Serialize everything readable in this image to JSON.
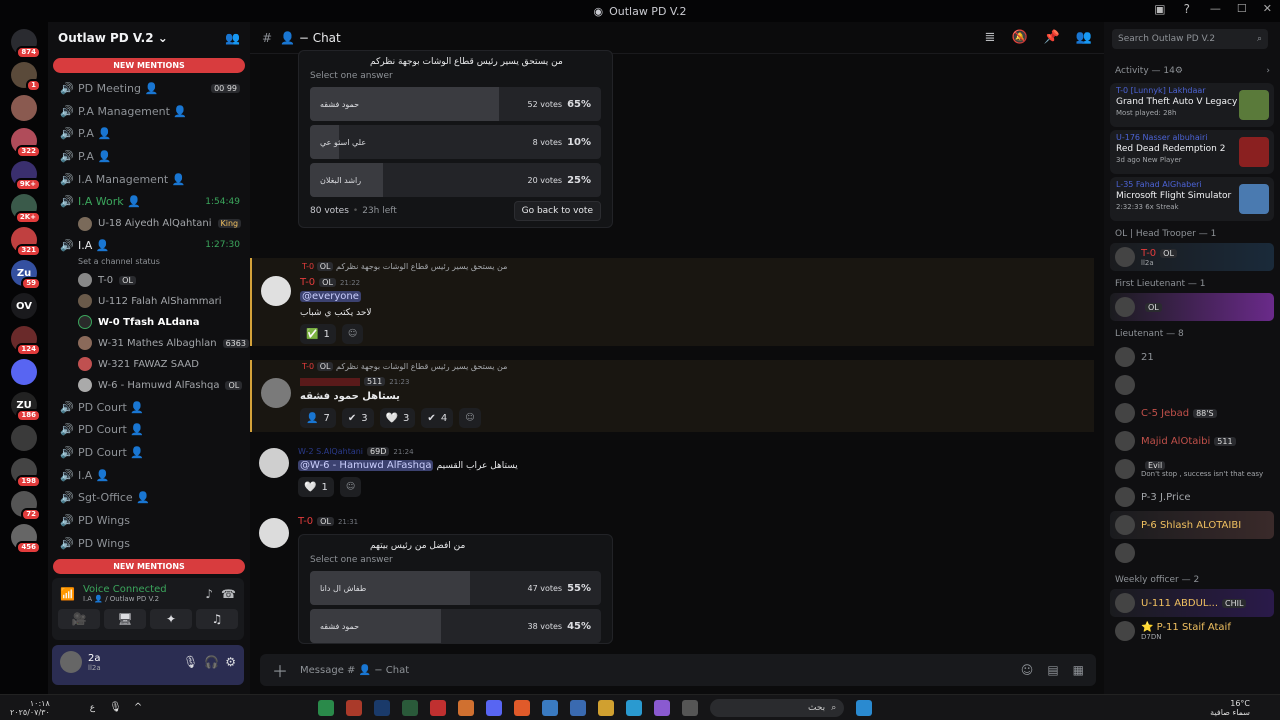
{
  "window": {
    "title": "Outlaw PD V.2"
  },
  "servers": [
    {
      "label": "",
      "badge": "874",
      "color": "#2a2b30"
    },
    {
      "label": "",
      "badge": "1",
      "color": "#5a4a3a"
    },
    {
      "label": "",
      "badge": "",
      "color": "#8a5a50"
    },
    {
      "label": "",
      "badge": "322",
      "color": "#b04c5a"
    },
    {
      "label": "",
      "badge": "9K+",
      "color": "#3a2f6e"
    },
    {
      "label": "",
      "badge": "2K+",
      "color": "#3a5a4a"
    },
    {
      "label": "",
      "badge": "321",
      "color": "#c04040"
    },
    {
      "label": "Zu",
      "badge": "59",
      "color": "#3450a0"
    },
    {
      "label": "OV",
      "badge": "",
      "color": "#1a1a1d"
    },
    {
      "label": "",
      "badge": "124",
      "color": "#6a2a2a"
    },
    {
      "label": "",
      "badge": "",
      "color": "#5865f2"
    },
    {
      "label": "ZU",
      "badge": "186",
      "color": "#222"
    },
    {
      "label": "",
      "badge": "",
      "color": "#3a3a3a"
    },
    {
      "label": "",
      "badge": "198",
      "color": "#444"
    },
    {
      "label": "",
      "badge": "72",
      "color": "#555"
    },
    {
      "label": "",
      "badge": "456",
      "color": "#666"
    }
  ],
  "sidebar": {
    "guild_name": "Outlaw PD V.2",
    "new_mentions": "NEW MENTIONS",
    "new_label": "NEW",
    "channels": [
      {
        "name": "PD Meeting 👤",
        "time": "",
        "badge": "00 99"
      },
      {
        "name": "P.A Management 👤",
        "time": ""
      },
      {
        "name": "P.A 👤",
        "time": ""
      },
      {
        "name": "P.A 👤",
        "time": ""
      },
      {
        "name": "I.A Management 👤",
        "time": ""
      },
      {
        "name": "I.A Work 👤",
        "time": "1:54:49",
        "active": true
      }
    ],
    "ia_work_user": "U-18 Aiyedh AlQahtani",
    "ia_work_tag": "King",
    "ia_channel": "I.A 👤",
    "ia_time": "1:27:30",
    "set_status": "Set a channel status",
    "ia_users": [
      {
        "name": "T-0",
        "tag": "OL"
      },
      {
        "name": "U-112 Falah AlShammari",
        "tag": ""
      },
      {
        "name": "W-0 Tfash ALdana",
        "tag": ""
      },
      {
        "name": "W-31 Mathes Albaghlan",
        "tag": "6363"
      },
      {
        "name": "W-321 FAWAZ SAAD",
        "tag": ""
      },
      {
        "name": "W-6 - Hamuwd AlFashqa",
        "tag": "OL"
      }
    ],
    "more_channels": [
      "PD Court 👤",
      "PD Court 👤",
      "PD Court 👤",
      "I.A 👤",
      "Sgt-Office 👤",
      "PD Wings",
      "PD Wings",
      "PD Waiting"
    ]
  },
  "voice": {
    "status": "Voice Connected",
    "location": "I.A 👤 / Outlaw PD V.2"
  },
  "user": {
    "name": "2a",
    "sub": "ll2a"
  },
  "header": {
    "channel": "👤 − Chat",
    "search_placeholder": "Search Outlaw PD V.2"
  },
  "poll1": {
    "question": "من يستحق يسير رئيس قطاع الوشات بوجهة نظركم",
    "select": "Select one answer",
    "answers": [
      {
        "label": "حمود فشقه",
        "votes": "52 votes",
        "pct": "65%",
        "frac": 0.65
      },
      {
        "label": "علي اسثو عي",
        "votes": "8 votes",
        "pct": "10%",
        "frac": 0.1
      },
      {
        "label": "راشد البغلان",
        "votes": "20 votes",
        "pct": "25%",
        "frac": 0.25
      }
    ],
    "total": "80 votes",
    "left": "23h left",
    "button": "Go back to vote"
  },
  "msg1": {
    "reply": "من يستحق يسير رئيس قطاع الوشات بوجهة نظركم",
    "reply_user": "T-0",
    "reply_tag": "OL",
    "user": "T-0",
    "tag": "OL",
    "time": "21:22",
    "mention": "@everyone",
    "text": "لاحد يكتب ي شباب",
    "reactions": [
      {
        "emoji": "✅",
        "count": "1"
      }
    ]
  },
  "msg2": {
    "reply": "من يستحق يسير رئيس قطاع الوشات بوجهة نظركم",
    "reply_user": "T-0",
    "reply_tag": "OL",
    "user": "",
    "tag": "511",
    "time": "21:23",
    "text": "يستاهل حمود فشقه",
    "reactions": [
      {
        "emoji": "👤",
        "count": "7"
      },
      {
        "emoji": "✔",
        "count": "3"
      },
      {
        "emoji": "🤍",
        "count": "3"
      },
      {
        "emoji": "✔",
        "count": "4"
      }
    ]
  },
  "msg3": {
    "user": "W-2 S.AlQahtani",
    "tag": "69D",
    "time": "21:24",
    "mention": "@W-6 - Hamuwd AlFashqa",
    "text": "يستاهل عراب القسيم",
    "reactions": [
      {
        "emoji": "🤍",
        "count": "1"
      }
    ]
  },
  "msg4": {
    "user": "T-0",
    "tag": "OL",
    "time": "21:31"
  },
  "poll2": {
    "question": "من افضل من رئيس بيتهم",
    "select": "Select one answer",
    "answers": [
      {
        "label": "طفاش ال دانا",
        "votes": "47 votes",
        "pct": "55%",
        "frac": 0.55
      },
      {
        "label": "حمود فشقه",
        "votes": "38 votes",
        "pct": "45%",
        "frac": 0.45
      }
    ]
  },
  "composer": {
    "placeholder": "Message # 👤 − Chat"
  },
  "activity": {
    "title": "Activity — 14",
    "cards": [
      {
        "user": "T-0 [Lunnyk] Lakhdaar",
        "game": "Grand Theft Auto V Legacy",
        "meta": "Most played: 28h",
        "color": "#5a7a3a"
      },
      {
        "user": "U-176 Nasser albuhairi",
        "game": "Red Dead Redemption 2",
        "meta": "3d ago   New Player",
        "color": "#8a2020"
      },
      {
        "user": "L-35 Fahad AlGhaberi",
        "game": "Microsoft Flight Simulator",
        "meta": "2:32:33   6x Streak",
        "color": "#4a7ab0"
      }
    ]
  },
  "members": {
    "groups": [
      {
        "title": "OL | Head Trooper — 1",
        "items": [
          {
            "name": "T-0",
            "sub": "ll2a",
            "tag": "OL",
            "color": "#e23c3c",
            "banner": "#1a2a3a"
          }
        ]
      },
      {
        "title": "First Lieutenant — 1",
        "items": [
          {
            "name": "",
            "sub": "",
            "tag": "OL",
            "color": "#e23c3c",
            "banner": "#6a2a8a"
          }
        ]
      },
      {
        "title": "Lieutenant — 8",
        "items": [
          {
            "name": "21",
            "tag": "",
            "color": "#8e9297"
          },
          {
            "name": "",
            "tag": "",
            "color": "#8e9297"
          },
          {
            "name": "C-5 Jebad",
            "tag": "88'S",
            "color": "#c0504a"
          },
          {
            "name": "Majid AlOtaibi",
            "tag": "511",
            "color": "#c0504a"
          },
          {
            "name": "",
            "tag": "Evil",
            "sub": "Don't stop , success isn't that easy",
            "color": "#c0504a"
          },
          {
            "name": "P-3 J.Price",
            "tag": "",
            "color": "#a3a6aa"
          },
          {
            "name": "P-6 Shlash ALOTAIBI",
            "tag": "",
            "color": "#f0c060",
            "banner": "#3a2a2a"
          },
          {
            "name": "",
            "tag": "",
            "color": "#e23c3c"
          }
        ]
      },
      {
        "title": "Weekly officer — 2",
        "items": [
          {
            "name": "U-111 ABDUL...",
            "tag": "CHIL",
            "color": "#f0c060",
            "banner": "#2a1a4a"
          },
          {
            "name": "⭐ P-11 Staif Ataif",
            "sub": "D7DN",
            "tag": "",
            "color": "#f0c060"
          }
        ]
      }
    ]
  },
  "taskbar": {
    "search": "بحث",
    "weather": "16°C",
    "weather_desc": "سماء صافية",
    "time": "١٠:١٨",
    "date": "٢٠٢٥/٠٧/٣٠",
    "lang": "ع"
  }
}
